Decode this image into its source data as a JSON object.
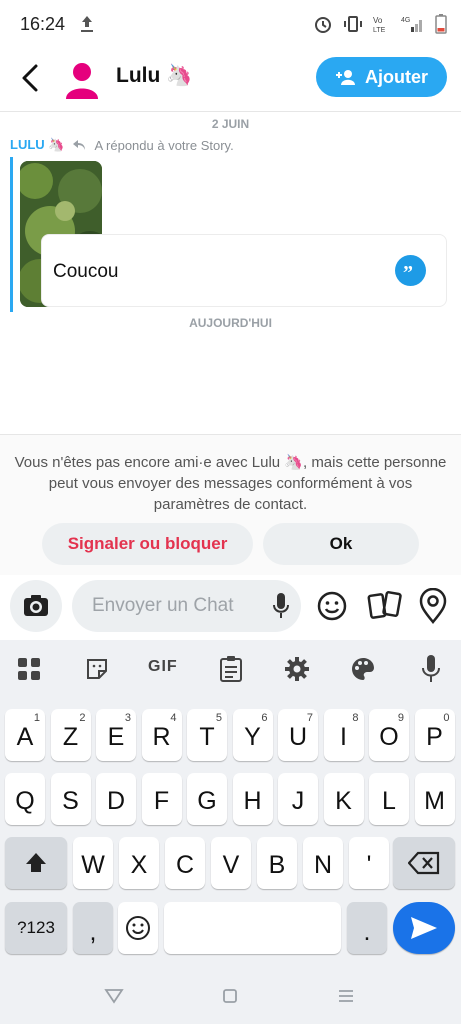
{
  "status": {
    "time": "16:24"
  },
  "header": {
    "name": "Lulu 🦄",
    "add_label": "Ajouter"
  },
  "chat": {
    "date1": "2 JUIN",
    "reply_sender": "LULU 🦄",
    "reply_text": "A répondu à votre Story.",
    "message": "Coucou",
    "date2": "AUJOURD'HUI"
  },
  "notice": {
    "text": "Vous n'êtes pas encore ami·e avec Lulu 🦄, mais cette personne peut vous envoyer des messages conformément à vos paramètres de contact.",
    "report_label": "Signaler ou bloquer",
    "ok_label": "Ok"
  },
  "input": {
    "placeholder": "Envoyer un Chat"
  },
  "keyboard": {
    "gif_label": "GIF",
    "row1": [
      "A",
      "Z",
      "E",
      "R",
      "T",
      "Y",
      "U",
      "I",
      "O",
      "P"
    ],
    "row1_nums": [
      "1",
      "2",
      "3",
      "4",
      "5",
      "6",
      "7",
      "8",
      "9",
      "0"
    ],
    "row2": [
      "Q",
      "S",
      "D",
      "F",
      "G",
      "H",
      "J",
      "K",
      "L",
      "M"
    ],
    "row3": [
      "W",
      "X",
      "C",
      "V",
      "B",
      "N",
      "'"
    ],
    "sym_label": "?123",
    "comma": ",",
    "period": "."
  },
  "colors": {
    "accent": "#2aa8f2",
    "report": "#e3334f",
    "avatar": "#e5007d"
  }
}
